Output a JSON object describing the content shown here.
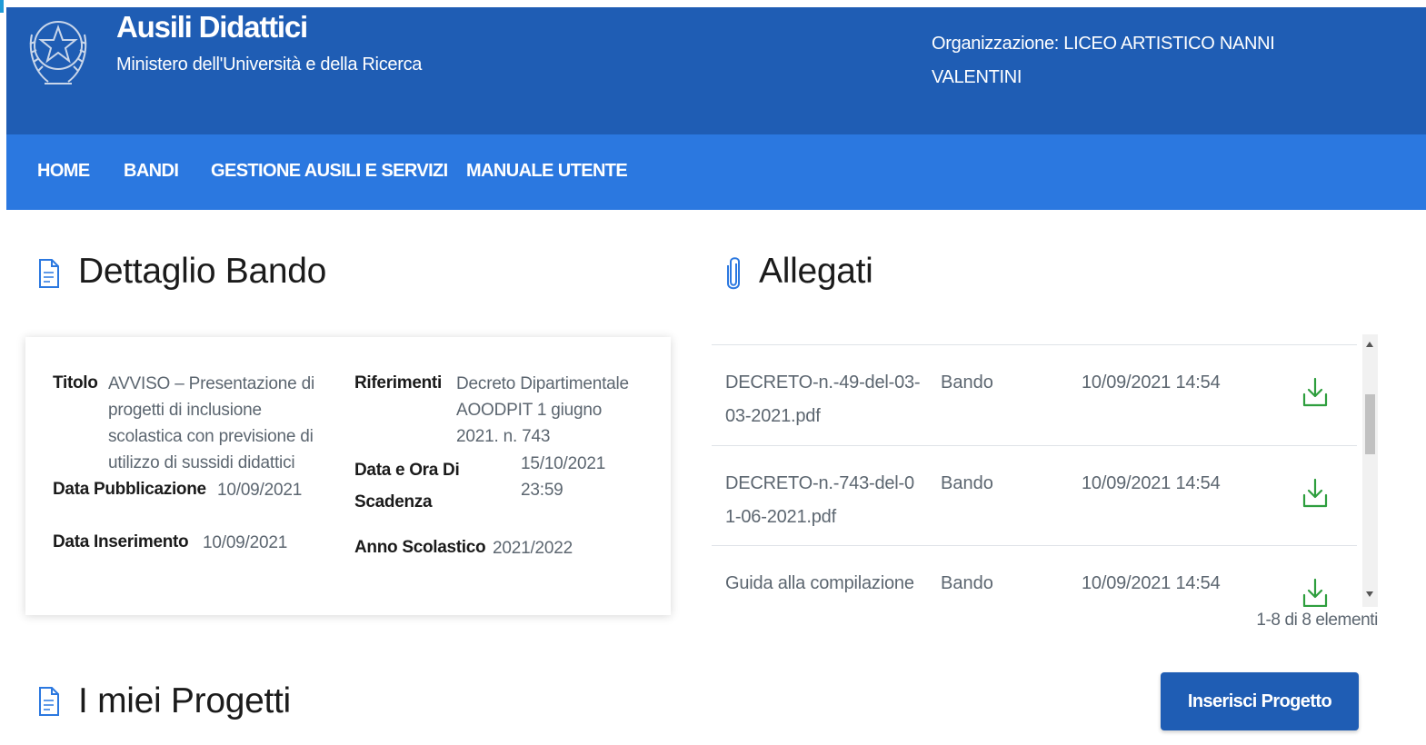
{
  "header": {
    "title": "Ausili Didattici",
    "subtitle": "Ministero dell'Università e della Ricerca",
    "organization_line1": "Organizzazione: LICEO ARTISTICO NANNI",
    "organization_line2": "VALENTINI"
  },
  "nav": {
    "items": [
      "HOME",
      "BANDI",
      "GESTIONE AUSILI E SERVIZI",
      "MANUALE UTENTE"
    ]
  },
  "detail": {
    "section_title": "Dettaglio Bando",
    "titolo_label": "Titolo",
    "titolo_value": "AVVISO – Presentazione di progetti di inclusione scolastica con previsione di utilizzo di sussidi didattici",
    "riferimenti_label": "Riferimenti",
    "riferimenti_value": "Decreto Dipartimentale AOODPIT 1 giugno 2021. n. 743",
    "data_pubblicazione_label": "Data Pubblicazione",
    "data_pubblicazione_value": "10/09/2021",
    "data_scadenza_label": "Data e Ora Di Scadenza",
    "data_scadenza_value": "15/10/2021 23:59",
    "data_inserimento_label": "Data Inserimento",
    "data_inserimento_value": "10/09/2021",
    "anno_scolastico_label": "Anno Scolastico",
    "anno_scolastico_value": "2021/2022"
  },
  "attachments": {
    "section_title": "Allegati",
    "rows": [
      {
        "name": "DECRETO-n.-49-del-03-03-2021.pdf",
        "type": "Bando",
        "date": "10/09/2021 14:54"
      },
      {
        "name": "DECRETO-n.-743-del-01-06-2021.pdf",
        "type": "Bando",
        "date": "10/09/2021 14:54"
      },
      {
        "name": "Guida alla compilazione",
        "type": "Bando",
        "date": "10/09/2021 14:54"
      }
    ],
    "pager": "1-8 di 8 elementi"
  },
  "projects": {
    "section_title": "I miei Progetti",
    "insert_button": "Inserisci Progetto"
  },
  "colors": {
    "header_bg": "#1f5db4",
    "nav_bg": "#2b78e0",
    "download_icon": "#2e9e3e",
    "accent": "#1f5db4"
  },
  "icons": [
    "emblem-icon",
    "document-icon",
    "paperclip-icon",
    "download-icon"
  ]
}
